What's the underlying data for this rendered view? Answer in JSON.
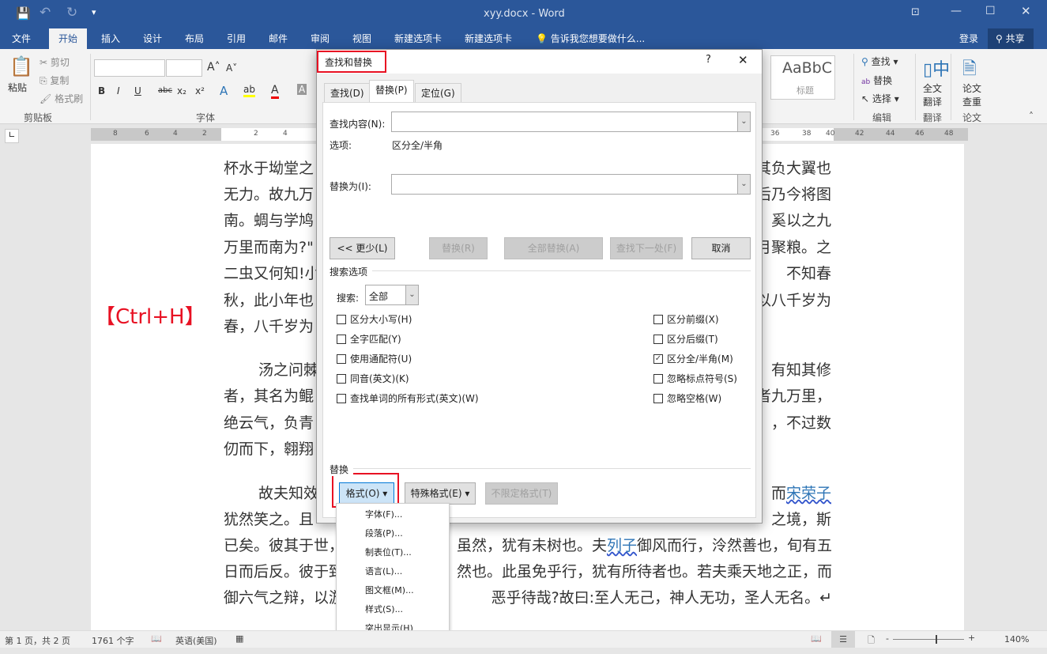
{
  "window": {
    "title": "xyy.docx - Word"
  },
  "quick_access": [
    "save-icon",
    "undo-icon",
    "redo-icon",
    "customize-icon"
  ],
  "ribbon_tabs": [
    "文件",
    "开始",
    "插入",
    "设计",
    "布局",
    "引用",
    "邮件",
    "审阅",
    "视图",
    "新建选项卡",
    "新建选项卡"
  ],
  "tell_me": "告诉我您想要做什么...",
  "signin": "登录",
  "share": "共享",
  "clipboard": {
    "paste": "粘贴",
    "cut": "剪切",
    "copy": "复制",
    "format_painter": "格式刷",
    "group": "剪贴板"
  },
  "font": {
    "group": "字体"
  },
  "styles": {
    "preview": "AaBbC",
    "heading": "标题"
  },
  "editing": {
    "find": "查找",
    "replace": "替换",
    "select": "选择",
    "group": "编辑"
  },
  "translate": {
    "label1": "全文",
    "label2": "翻译",
    "group": "翻译"
  },
  "paper": {
    "label1": "论文",
    "label2": "查重",
    "group": "论文"
  },
  "ruler": {
    "left": [
      "8",
      "6",
      "4",
      "2",
      "2",
      "4",
      "6"
    ],
    "right": [
      "36",
      "38",
      "40",
      "42",
      "44",
      "46",
      "48"
    ]
  },
  "annotation": "【Ctrl+H】",
  "document": {
    "lines": [
      {
        "l": "杯水于坳堂之",
        "r": "其负大翼也"
      },
      {
        "l": "无力。故九万",
        "r": "后乃今将图"
      },
      {
        "l": "南。蜩与学鸠",
        "r": "奚以之九"
      },
      {
        "l": "万里而南为?\"",
        "r": "月聚粮。之"
      },
      {
        "l": "二虫又何知!小",
        "r": "不知春"
      },
      {
        "l": "秋，此小年也",
        "r": "以八千岁为"
      },
      {
        "l": "春，八千岁为",
        "r": ""
      },
      {
        "l": "汤之问棘",
        "r": "有知其修"
      },
      {
        "l": "者，其名为鲲",
        "r": "者九万里，"
      },
      {
        "l": "绝云气，负青",
        "r": "，不过数"
      },
      {
        "l": "仞而下，翱翔",
        "r": ""
      },
      {
        "l": "故夫知效",
        "r": "而",
        "link": "宋荣子"
      },
      {
        "l": "犹然笑之。且",
        "r": "之境，斯"
      },
      {
        "l": "已矣。彼其于世，",
        "r": "虽然，犹有未树也。夫",
        "link": "列子",
        "r2": "御风而行，泠然善也，旬有五"
      },
      {
        "l": "日而后反。彼于致",
        "r": "然也。此虽免乎行，犹有所待者也。若夫乘天地之正，而"
      },
      {
        "l": "御六气之辩，以游",
        "r": "恶乎待哉?故曰:至人无己，神人无功，圣人无名。↵"
      }
    ]
  },
  "dialog": {
    "title": "查找和替换",
    "help": "?",
    "close": "✕",
    "tabs": [
      "查找(D)",
      "替换(P)",
      "定位(G)"
    ],
    "find_label": "查找内容(N):",
    "find_value": "",
    "options_label": "选项:",
    "options_value": "区分全/半角",
    "replace_label": "替换为(I):",
    "replace_value": "",
    "less": "<< 更少(L)",
    "replace": "替换(R)",
    "replace_all": "全部替换(A)",
    "find_next": "查找下一处(F)",
    "cancel": "取消",
    "search_options": "搜索选项",
    "search_label": "搜索:",
    "search_value": "全部",
    "left_checks": [
      {
        "label": "区分大小写(H)",
        "checked": false
      },
      {
        "label": "全字匹配(Y)",
        "checked": false
      },
      {
        "label": "使用通配符(U)",
        "checked": false
      },
      {
        "label": "同音(英文)(K)",
        "checked": false
      },
      {
        "label": "查找单词的所有形式(英文)(W)",
        "checked": false
      }
    ],
    "right_checks": [
      {
        "label": "区分前缀(X)",
        "checked": false
      },
      {
        "label": "区分后缀(T)",
        "checked": false
      },
      {
        "label": "区分全/半角(M)",
        "checked": true
      },
      {
        "label": "忽略标点符号(S)",
        "checked": false
      },
      {
        "label": "忽略空格(W)",
        "checked": false
      }
    ],
    "replace_section": "替换",
    "format": "格式(O)",
    "special": "特殊格式(E)",
    "no_format": "不限定格式(T)"
  },
  "format_menu": [
    "字体(F)...",
    "段落(P)...",
    "制表位(T)...",
    "语言(L)...",
    "图文框(M)...",
    "样式(S)...",
    "突出显示(H)"
  ],
  "status": {
    "page": "第 1 页，共 2 页",
    "words": "1761 个字",
    "language": "英语(美国)",
    "zoom": "140%",
    "zoom_level": 140
  },
  "colors": {
    "brand": "#2b579a",
    "highlight": "#e81123"
  }
}
